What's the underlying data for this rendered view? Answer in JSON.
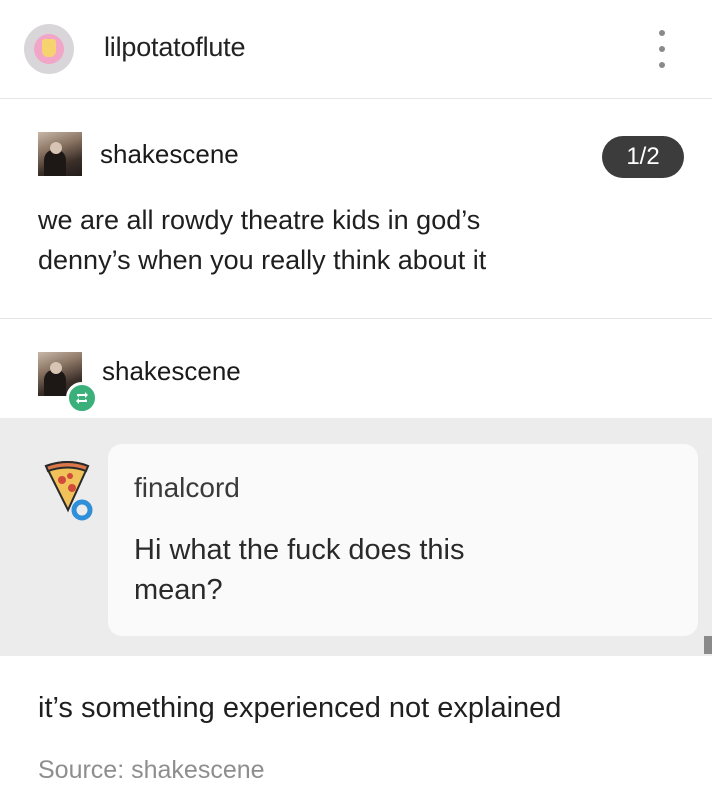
{
  "header": {
    "username": "lilpotatoflute",
    "avatar_icon": "french-fries-icon",
    "menu_icon": "kebab-menu-icon"
  },
  "post": {
    "author": "shakescene",
    "page_indicator": "1/2",
    "text_line1": "we are all rowdy theatre kids in god’s",
    "text_line2": "denny’s when you really think about it"
  },
  "reblog": {
    "author": "shakescene",
    "badge_icon": "reblog-icon",
    "badge_color": "#3bb07a"
  },
  "ask": {
    "asker": "finalcord",
    "asker_icon": "pizza-slice-icon",
    "question_line1": "Hi what the fuck does this",
    "question_line2": "mean?"
  },
  "answer": {
    "text": "it’s something experienced not explained"
  },
  "source": {
    "text": "Source: shakescene"
  }
}
